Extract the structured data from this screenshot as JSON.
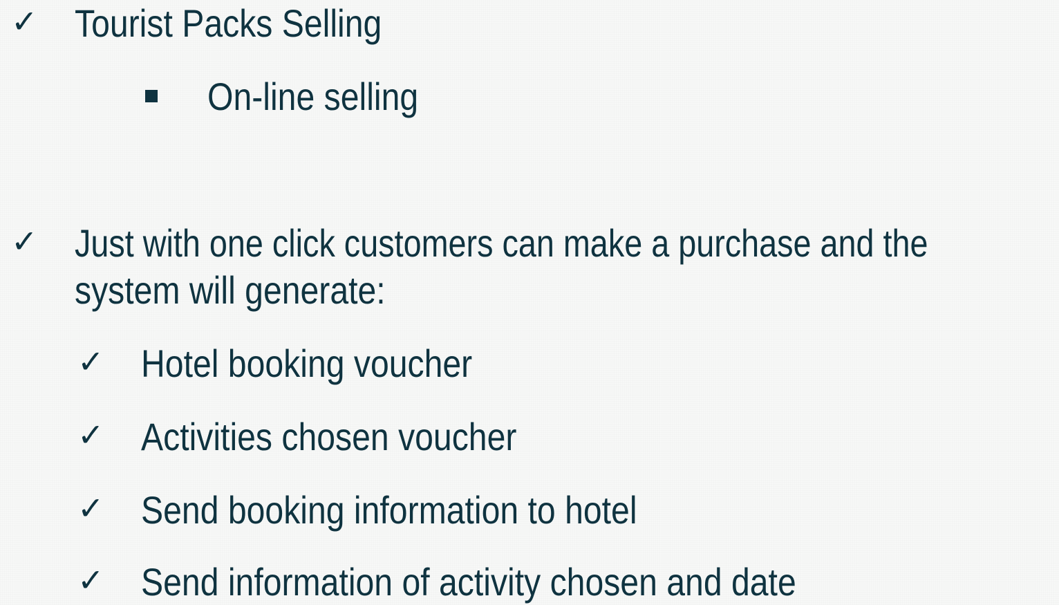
{
  "slide": {
    "items": [
      {
        "text": "Tourist Packs Selling"
      },
      {
        "text": "On-line selling"
      },
      {
        "text_line1": "Just with one click  customers can make a purchase and the",
        "text_line2": "system will generate:"
      },
      {
        "text": "Hotel booking voucher"
      },
      {
        "text": "Activities chosen voucher"
      },
      {
        "text": "Send booking information to hotel"
      },
      {
        "text": "Send information of activity chosen and date"
      }
    ],
    "check_glyph": "✓",
    "bullet_icon": "check-icon",
    "square_icon": "square-bullet-icon",
    "text_color": "#0f3340",
    "background_color": "#f7f8f7"
  }
}
